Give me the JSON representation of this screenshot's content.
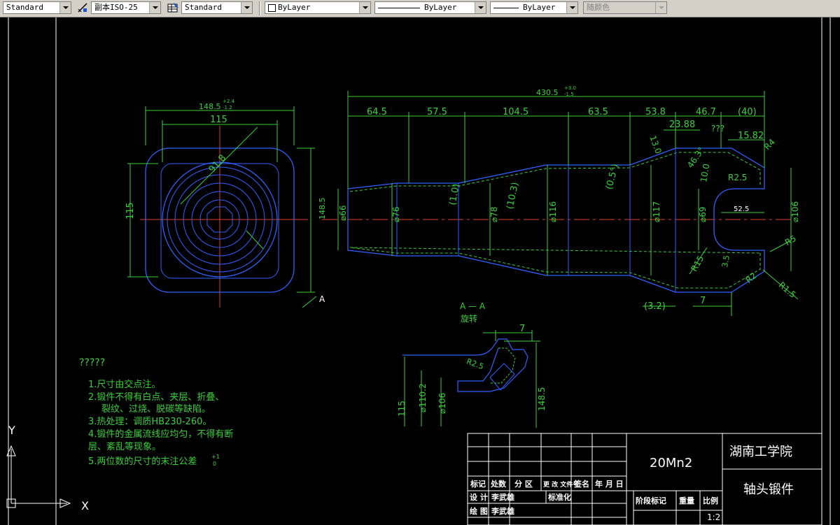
{
  "toolbar": {
    "text_style": "Standard",
    "dim_style": "副本ISO-25",
    "table_style": "Standard",
    "layer_color": "ByLayer",
    "linetype": "ByLayer",
    "lineweight": "ByLayer",
    "plot_style": "随颜色"
  },
  "section": {
    "title": "A — A",
    "subtitle": "旋转",
    "view_marker": "A"
  },
  "dims_left": {
    "top_width": "148.5",
    "top_width_tol_up": "+2.4",
    "top_width_tol_dn": "-1.2",
    "inner_width": "115",
    "diag": "91.8",
    "left_height": "115",
    "right_height": "148.5",
    "right_height_tol": "+2.4 -1.2"
  },
  "dims_main": {
    "overall": "430.5",
    "overall_tol_up": "+3.0",
    "overall_tol_dn": "-1.5",
    "segments": [
      "64.5",
      "57.5",
      "104.5",
      "63.5",
      "53.8",
      "46.7",
      "(40)"
    ],
    "top_right": [
      "23.88",
      "???",
      "15.82"
    ],
    "angles": [
      "(1.0)",
      "(10.3)",
      "(0.5°)",
      "13.0",
      "46.3°",
      "10.0"
    ],
    "diameters": [
      "⌀66",
      "⌀76",
      "⌀78",
      "⌀116",
      "⌀117",
      "⌀69",
      "⌀106"
    ],
    "d66_tol": "+1 0",
    "radii": [
      "R4",
      "R2.5",
      "R5",
      "R15",
      "R2",
      "R1.5"
    ],
    "inner_len": "52.5",
    "small": "3.5",
    "bottom": [
      "(3.2)",
      "7"
    ]
  },
  "section_dims": {
    "top": "7",
    "r": "R2.5",
    "verticals": [
      "115",
      "⌀110.2",
      "⌀106",
      "148.5"
    ],
    "v_tol": "+0.5 -1.0"
  },
  "notes": {
    "header": "?????",
    "lines": [
      "1.尺寸由交点注。",
      "2.锻件不得有白点、夹层、折叠、",
      "裂纹、过烧、脱碳等缺陷。",
      "3.热处理：调质HB230-260。",
      "4.锻件的金属流线应均匀，不得有断",
      "层、紊乱等现象。",
      "5.两位数的尺寸的末注公差"
    ],
    "tol": "+1",
    "tol2": "0"
  },
  "title_block": {
    "material": "20Mn2",
    "school": "湖南工学院",
    "part_name": "轴头锻件",
    "headers": [
      "标记",
      "处数",
      "分 区",
      "更 改\n文件号",
      "签名",
      "年 月 日"
    ],
    "design_label": "设  计",
    "design_name": "李武雄",
    "std_label": "标准化",
    "draw_label": "绘  图",
    "draw_name": "李武雄",
    "stage_label": "阶段标记",
    "weight_label": "重量",
    "scale_label": "比例",
    "scale": "1:2"
  },
  "ucs": {
    "x": "X",
    "y": "Y"
  }
}
